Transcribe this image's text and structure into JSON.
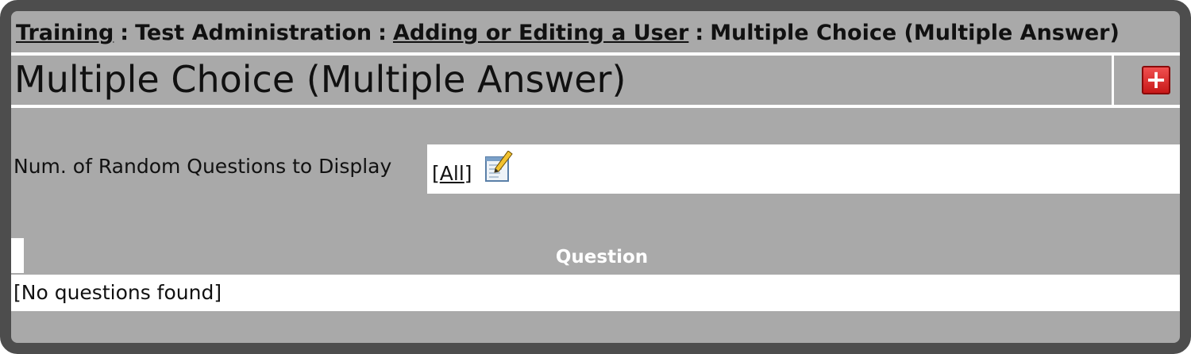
{
  "breadcrumb": {
    "items": [
      {
        "label": "Training",
        "link": true
      },
      {
        "label": "Test Administration",
        "link": false
      },
      {
        "label": "Adding or Editing a User",
        "link": true
      },
      {
        "label": "Multiple Choice (Multiple Answer)",
        "link": false
      }
    ],
    "separator": ":"
  },
  "page": {
    "title": "Multiple Choice (Multiple Answer)",
    "add_icon": "plus-icon"
  },
  "settings": {
    "random_questions_label": "Num. of Random Questions to Display",
    "random_questions_value": "All",
    "bracket_open": "[",
    "bracket_close": "]",
    "edit_icon": "edit-notepad-icon"
  },
  "questions_table": {
    "column_header": "Question",
    "empty_message": "[No questions found]"
  },
  "colors": {
    "frame_border": "#4d4d4d",
    "panel_gray": "#a9a9a9",
    "add_button_red": "#d82020"
  }
}
